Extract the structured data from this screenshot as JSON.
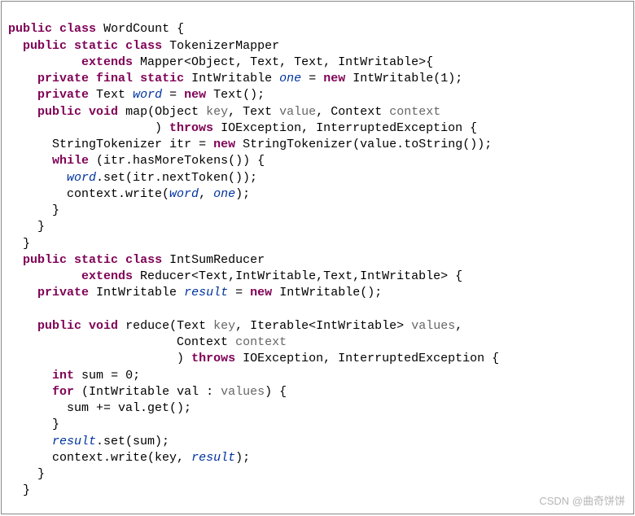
{
  "code": {
    "l1": {
      "kw1": "public",
      "kw2": "class",
      "cls": "WordCount",
      "br": "{"
    },
    "l2": {
      "kw1": "public",
      "kw2": "static",
      "kw3": "class",
      "cls": "TokenizerMapper"
    },
    "l3": {
      "kw": "extends",
      "txt": "Mapper<Object, Text, Text, IntWritable>{"
    },
    "l4": {
      "kw1": "private",
      "kw2": "final",
      "kw3": "static",
      "type": "IntWritable",
      "fld": "one",
      "eq": "=",
      "kw4": "new",
      "txt": "IntWritable(1);"
    },
    "l5": {
      "kw1": "private",
      "type": "Text",
      "fld": "word",
      "eq": "=",
      "kw2": "new",
      "txt": "Text();"
    },
    "l6": {
      "kw1": "public",
      "kw2": "void",
      "meth": "map",
      "paren": "(Object",
      "p1": "key",
      "c1": ", Text",
      "p2": "value",
      "c2": ", Context",
      "p3": "context"
    },
    "l7": {
      "paren": ") ",
      "kw": "throws",
      "txt": "IOException, InterruptedException {"
    },
    "l8": {
      "type": "StringTokenizer",
      "var": "itr",
      "eq": "=",
      "kw": "new",
      "txt": "StringTokenizer(value.toString());"
    },
    "l9": {
      "kw": "while",
      "txt": "(itr.hasMoreTokens()) {"
    },
    "l10": {
      "fld": "word",
      "txt": ".set(itr.nextToken());"
    },
    "l11": {
      "txt1": "context.write(",
      "fld1": "word",
      "c": ",",
      "fld2": "one",
      "txt2": ");"
    },
    "l12": {
      "br": "}"
    },
    "l13": {
      "br": "}"
    },
    "l14": {
      "br": "}"
    },
    "l15": {
      "kw1": "public",
      "kw2": "static",
      "kw3": "class",
      "cls": "IntSumReducer"
    },
    "l16": {
      "kw": "extends",
      "txt": "Reducer<Text,IntWritable,Text,IntWritable> {"
    },
    "l17": {
      "kw1": "private",
      "type": "IntWritable",
      "fld": "result",
      "eq": "=",
      "kw2": "new",
      "txt": "IntWritable();"
    },
    "l18": {
      "blank": ""
    },
    "l19": {
      "kw1": "public",
      "kw2": "void",
      "meth": "reduce",
      "paren": "(Text",
      "p1": "key",
      "c1": ", Iterable<IntWritable>",
      "p2": "values",
      "c2": ","
    },
    "l20": {
      "type": "Context",
      "p": "context"
    },
    "l21": {
      "paren": ") ",
      "kw": "throws",
      "txt": "IOException, InterruptedException {"
    },
    "l22": {
      "kw": "int",
      "var": "sum",
      "eq": "=",
      "num": "0;"
    },
    "l23": {
      "kw": "for",
      "paren": "(IntWritable",
      "var": "val",
      "colon": ":",
      "p": "values",
      "br": ") {"
    },
    "l24": {
      "txt": "sum += val.get();"
    },
    "l25": {
      "br": "}"
    },
    "l26": {
      "fld": "result",
      "txt": ".set(sum);"
    },
    "l27": {
      "txt1": "context.write(key,",
      "fld": "result",
      "txt2": ");"
    },
    "l28": {
      "br": "}"
    },
    "l29": {
      "br": "}"
    }
  },
  "watermark": "CSDN @曲奇饼饼"
}
